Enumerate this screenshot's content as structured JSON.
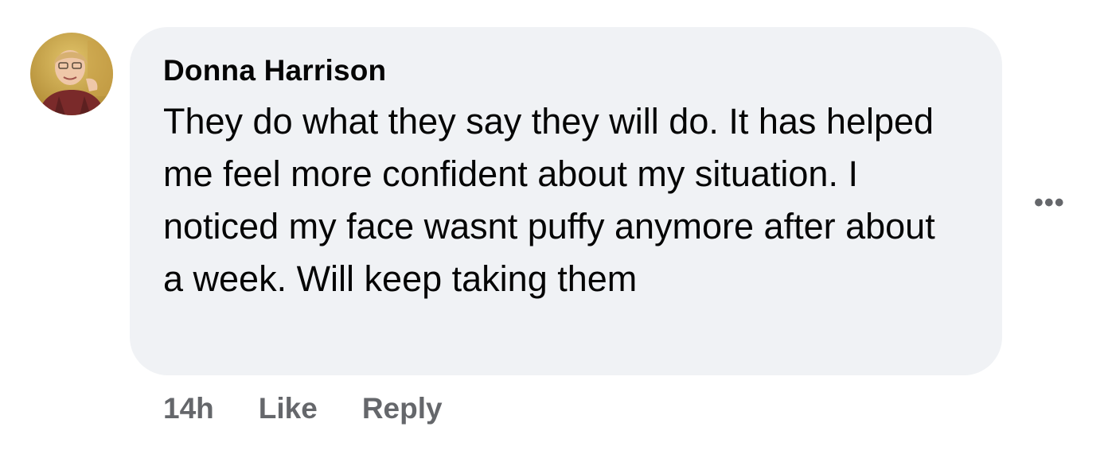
{
  "comment": {
    "author": "Donna Harrison",
    "text": "They do what they say they will do. It has helped me feel more confident about my situation. I noticed my face wasnt puffy anymore after about a week. Will keep taking them",
    "timestamp": "14h",
    "like_label": "Like",
    "reply_label": "Reply",
    "more_label": "•••",
    "avatar_icon": "profile-photo"
  },
  "colors": {
    "bubble_bg": "#f0f2f5",
    "text": "#050505",
    "secondary_text": "#65676b"
  }
}
